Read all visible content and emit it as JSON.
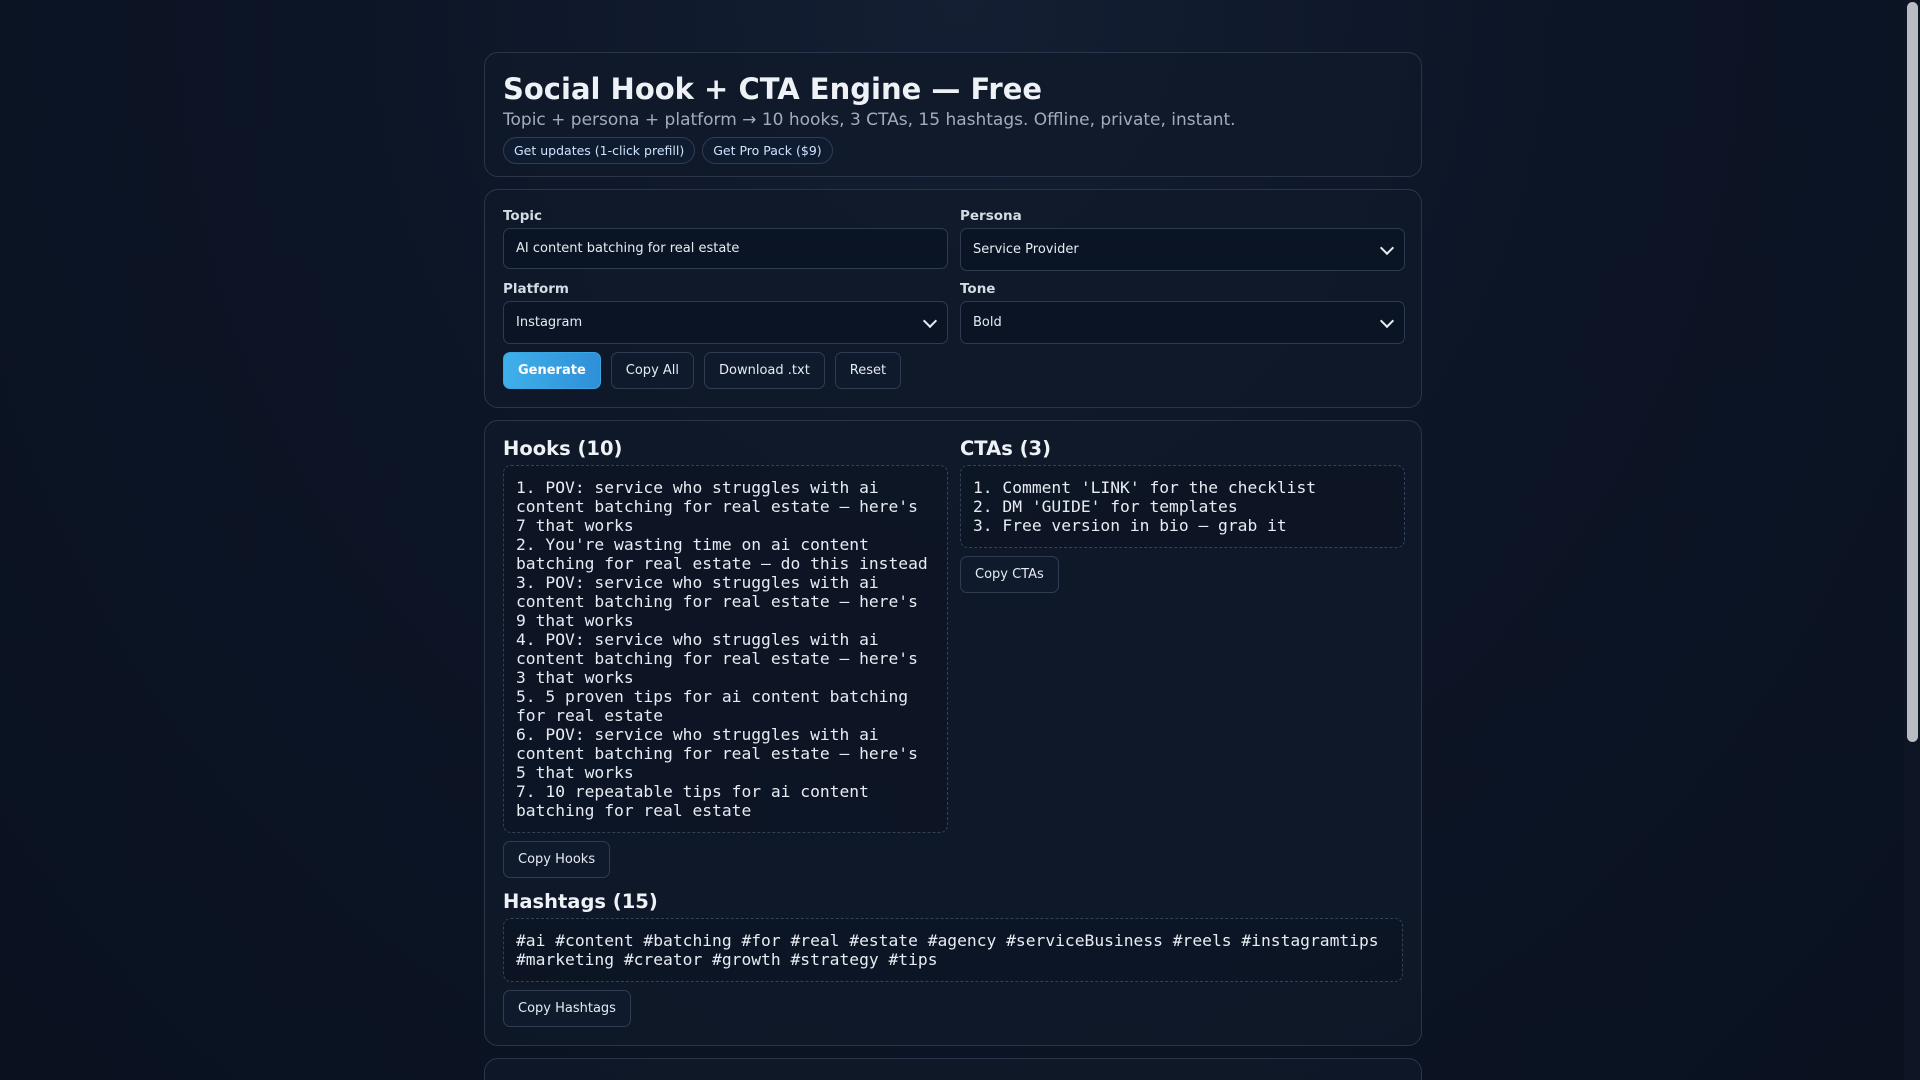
{
  "header": {
    "title": "Social Hook + CTA Engine — Free",
    "subtitle": "Topic + persona + platform → 10 hooks, 3 CTAs, 15 hashtags. Offline, private, instant.",
    "pill_updates": "Get updates (1-click prefill)",
    "pill_pro": "Get Pro Pack ($9)"
  },
  "form": {
    "topic_label": "Topic",
    "topic_value": "AI content batching for real estate",
    "persona_label": "Persona",
    "persona_value": "Service Provider",
    "platform_label": "Platform",
    "platform_value": "Instagram",
    "tone_label": "Tone",
    "tone_value": "Bold",
    "generate": "Generate",
    "copy_all": "Copy All",
    "download": "Download .txt",
    "reset": "Reset"
  },
  "hooks": {
    "heading": "Hooks (10)",
    "items": [
      "1. POV: service who struggles with ai content batching for real estate — here's 7 that works",
      "2. You're wasting time on ai content batching for real estate — do this instead",
      "3. POV: service who struggles with ai content batching for real estate — here's 9 that works",
      "4. POV: service who struggles with ai content batching for real estate — here's 3 that works",
      "5. 5 proven tips for ai content batching for real estate",
      "6. POV: service who struggles with ai content batching for real estate — here's 5 that works",
      "7. 10 repeatable tips for ai content batching for real estate"
    ],
    "copy": "Copy Hooks"
  },
  "ctas": {
    "heading": "CTAs (3)",
    "items": [
      "1. Comment 'LINK' for the checklist",
      "2. DM 'GUIDE' for templates",
      "3. Free version in bio — grab it"
    ],
    "copy": "Copy CTAs"
  },
  "hashtags": {
    "heading": "Hashtags (15)",
    "text": "#ai #content #batching #for #real #estate #agency #serviceBusiness #reels #instagramtips #marketing #creator #growth #strategy #tips",
    "copy": "Copy Hashtags"
  }
}
